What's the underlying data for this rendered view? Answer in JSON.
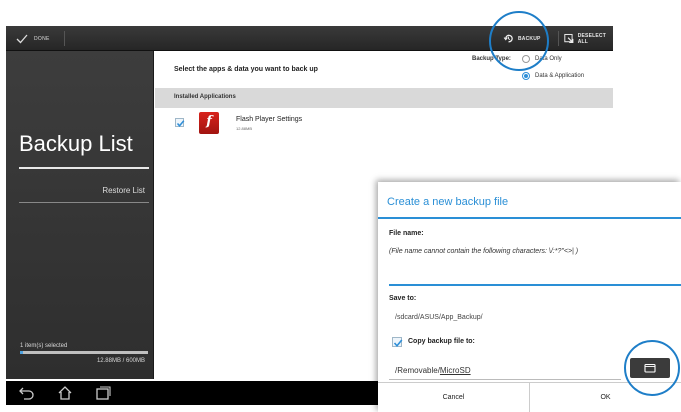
{
  "actionbar": {
    "done_label": "DONE",
    "backup_label": "BACKUP",
    "deselect_all_label": "DESELECT ALL"
  },
  "leftpanel": {
    "title": "Backup List",
    "restore_list": "Restore List",
    "selected_count": "1 item(s) selected",
    "storage_text": "12.88MB / 600MB",
    "storage_fraction": 0.0215
  },
  "main": {
    "prompt": "Select the apps & data you want to back up",
    "backup_type_label": "Backup Type:",
    "backup_type_options": [
      "Data Only",
      "Data & Application"
    ],
    "backup_type_selected": "Data & Application",
    "installed_header": "Installed Applications",
    "apps": [
      {
        "name": "Flash Player Settings",
        "size": "12.88MB",
        "checked": true,
        "icon_glyph": "f"
      }
    ]
  },
  "dialog": {
    "title": "Create a new backup file",
    "file_name_label": "File name:",
    "file_name_note": "(File name cannot contain the following characters: \\/:*?\"<>| )",
    "file_name_value": "",
    "save_to_label": "Save to:",
    "save_to_path": "/sdcard/ASUS/App_Backup/",
    "copy_label": "Copy backup file to:",
    "copy_checked": true,
    "copy_path_prefix": "/Removable/",
    "copy_path_device": "MicroSD",
    "cancel_label": "Cancel",
    "ok_label": "OK"
  },
  "navbar": {
    "icons": [
      "back-icon",
      "home-icon",
      "recent-apps-icon"
    ]
  },
  "colors": {
    "accent": "#2a8fd6",
    "callout": "#1e7ec8",
    "app_icon": "#c81e17"
  }
}
